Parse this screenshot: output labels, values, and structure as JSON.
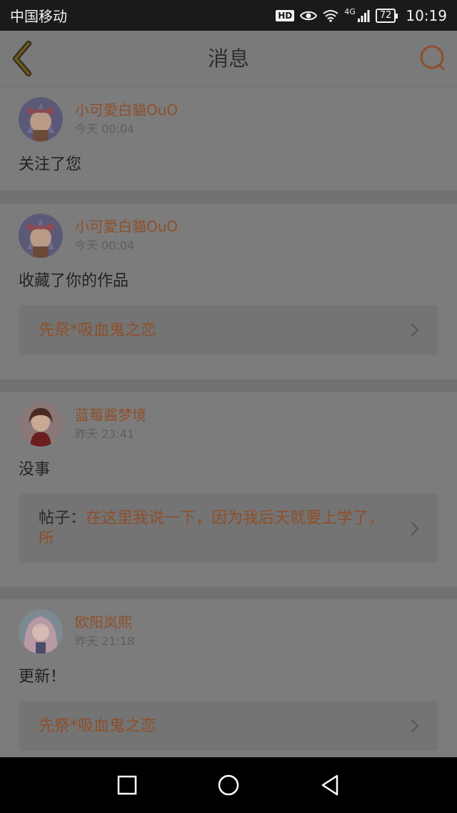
{
  "status_bar": {
    "carrier": "中国移动",
    "hd": "HD",
    "network": "4G",
    "battery": "72",
    "time": "10:19"
  },
  "header": {
    "title": "消息"
  },
  "messages": [
    {
      "user": "小可愛白貓OuO",
      "time": "今天 00:04",
      "text": "关注了您"
    },
    {
      "user": "小可愛白貓OuO",
      "time": "今天 00:04",
      "text": "收藏了你的作品",
      "link": "先祭*吸血鬼之恋"
    },
    {
      "user": "蓝莓酱梦境",
      "time": "昨天 23:41",
      "text": "没事",
      "link_prefix": "帖子：",
      "link": "在这里我说一下，因为我后天就要上学了，所"
    },
    {
      "user": "欧阳岚熙",
      "time": "昨天 21:18",
      "text": "更新！",
      "link": "先祭*吸血鬼之恋"
    }
  ],
  "colors": {
    "accent": "#8e4f2b",
    "overlay_bg": "#7c7c7c",
    "status_bar": "#1a1a1a",
    "nav_bar": "#000000"
  },
  "icons": [
    "back-icon",
    "search-icon",
    "chevron-right-icon",
    "home-square-icon",
    "home-circle-icon",
    "back-triangle-icon",
    "eye-icon",
    "wifi-icon",
    "signal-icon",
    "battery-icon"
  ]
}
